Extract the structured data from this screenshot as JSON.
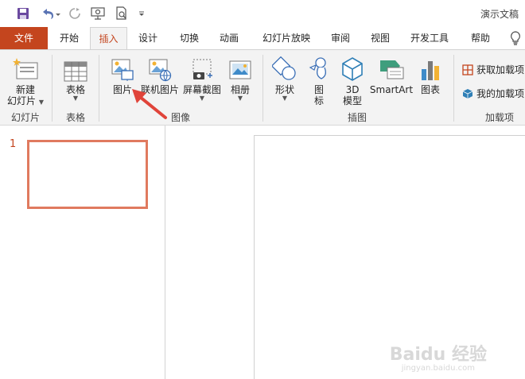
{
  "qat": {
    "save_icon": "save-icon",
    "undo_icon": "undo-icon",
    "redo_icon": "redo-icon",
    "present_icon": "present-from-start-icon",
    "preview_icon": "print-preview-icon",
    "customize_icon": "customize-toolbar-icon",
    "doc_title": "演示文稿"
  },
  "tabs": {
    "file": "文件",
    "home": "开始",
    "insert": "插入",
    "design": "设计",
    "transitions": "切换",
    "animations": "动画",
    "slideshow": "幻灯片放映",
    "review": "审阅",
    "view": "视图",
    "developer": "开发工具",
    "help": "帮助",
    "tell_me_icon": "lightbulb-icon"
  },
  "ribbon": {
    "new_slide": {
      "line1": "新建",
      "line2": "幻灯片"
    },
    "slides_group": "幻灯片",
    "table": "表格",
    "tables_group": "表格",
    "pictures": "图片",
    "online_pictures": "联机图片",
    "screenshot": "屏幕截图",
    "album": "相册",
    "images_group": "图像",
    "shapes": "形状",
    "icons": {
      "line1": "图",
      "line2": "标"
    },
    "models3d": {
      "line1": "3D",
      "line2": "模型"
    },
    "smartart": "SmartArt",
    "chart": "图表",
    "illustrations_group": "插图",
    "get_addins": "获取加载项",
    "my_addins": "我的加载项",
    "addins_group": "加载项"
  },
  "slides_pane": {
    "slide_number": "1"
  },
  "watermark": {
    "line1": "Baidu 经验",
    "line2": "jingyan.baidu.com"
  },
  "colors": {
    "accent": "#c4451e",
    "thumb_border": "#e07a5f",
    "arrow": "#e0443a"
  }
}
